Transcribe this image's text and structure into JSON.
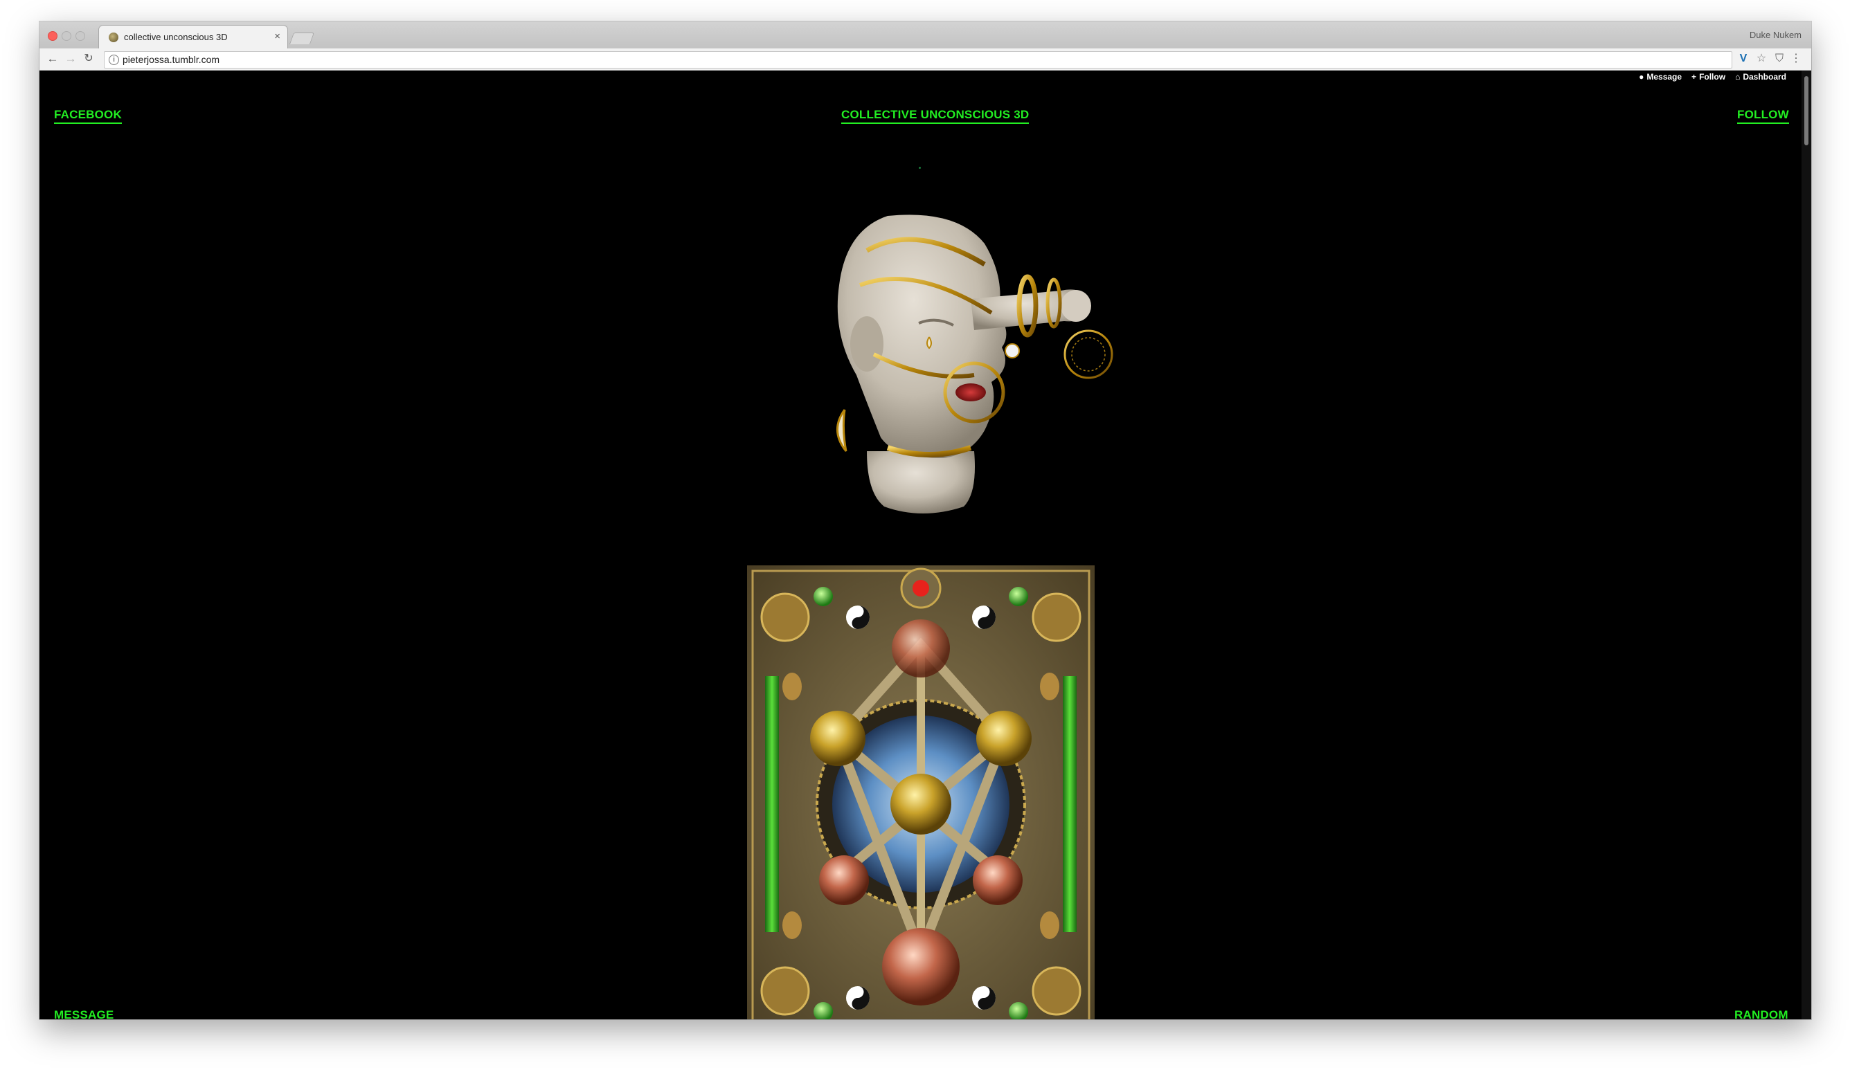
{
  "browser": {
    "tab": {
      "title": "collective unconscious 3D",
      "close": "×"
    },
    "profile": "Duke Nukem",
    "nav": {
      "back": "←",
      "forward": "→",
      "reload": "↻"
    },
    "address": "pieterjossa.tumblr.com",
    "icons": [
      "info-icon",
      "vivaldi-icon",
      "star-icon",
      "shield-icon",
      "menu-icon"
    ]
  },
  "tumblr_controls": [
    {
      "label": "Message",
      "icon": "chat-icon"
    },
    {
      "label": "Follow",
      "icon": "plus-icon"
    },
    {
      "label": "Dashboard",
      "icon": "home-icon"
    }
  ],
  "page": {
    "links": {
      "facebook": "FACEBOOK",
      "title": "COLLECTIVE UNCONSCIOUS 3D",
      "follow": "FOLLOW",
      "message": "MESSAGE",
      "random": "RANDOM"
    },
    "accent_color": "#22ee22",
    "background": "#000000"
  }
}
